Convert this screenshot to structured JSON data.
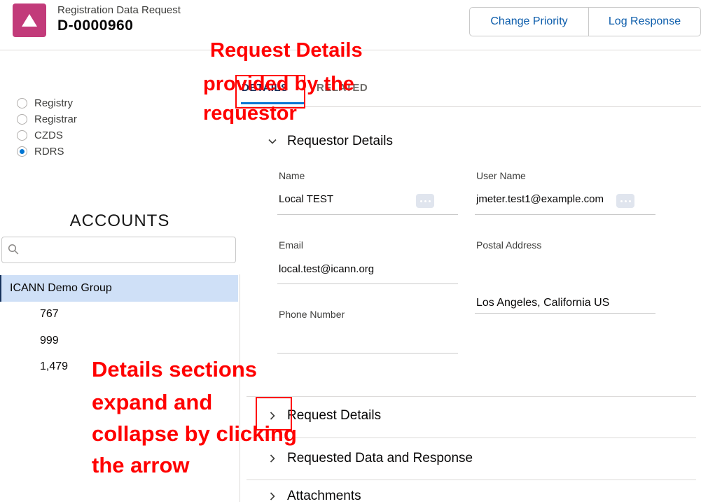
{
  "header": {
    "record_type": "Registration Data Request",
    "record_number": "D-0000960",
    "icon": "triangle-icon",
    "icon_color": "#c23b7a",
    "buttons": {
      "change_priority": "Change Priority",
      "log_response": "Log Response"
    }
  },
  "sources": {
    "options": [
      {
        "label": "Registry",
        "selected": false
      },
      {
        "label": "Registrar",
        "selected": false
      },
      {
        "label": "CZDS",
        "selected": false
      },
      {
        "label": "RDRS",
        "selected": true
      }
    ]
  },
  "accounts": {
    "title": "ACCOUNTS",
    "search": {
      "placeholder": "",
      "value": ""
    },
    "selected": "ICANN Demo Group",
    "items": [
      "767",
      "999",
      "1,479"
    ]
  },
  "tabs": {
    "details": "DETAILS",
    "related": "RELATED",
    "active": "details"
  },
  "sections": {
    "requestor": {
      "title": "Requestor Details",
      "expanded": true,
      "fields": {
        "name": {
          "label": "Name",
          "value": "Local TEST"
        },
        "user_name": {
          "label": "User Name",
          "value": "jmeter.test1@example.com"
        },
        "email": {
          "label": "Email",
          "value": "local.test@icann.org"
        },
        "postal_address": {
          "label": "Postal Address",
          "value": "Los Angeles, California US"
        },
        "phone_number": {
          "label": "Phone Number",
          "value": ""
        }
      }
    },
    "request_details": {
      "title": "Request Details",
      "expanded": false
    },
    "requested_data": {
      "title": "Requested Data and Response",
      "expanded": false
    },
    "attachments": {
      "title": "Attachments",
      "expanded": false
    }
  },
  "annotations": {
    "tab_note": [
      "Request Details",
      "provided by the",
      "requestor"
    ],
    "section_note": [
      "Details sections",
      "expand and",
      "collapse by clicking",
      "the arrow"
    ],
    "color": "#ff0000"
  },
  "colors": {
    "accent": "#0176d3",
    "link": "#0b5cab",
    "selected_row": "#cfe0f7"
  }
}
